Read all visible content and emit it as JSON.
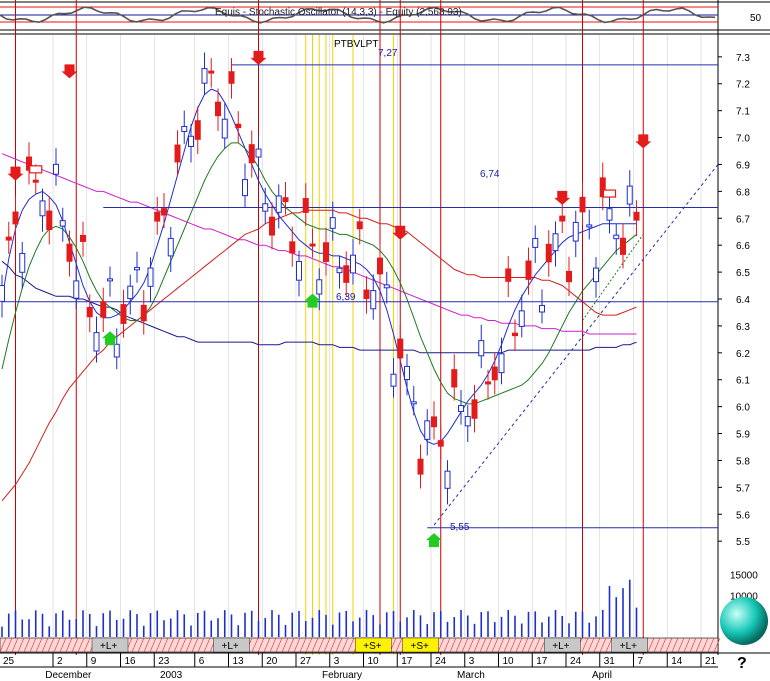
{
  "indicator_title": "Equis - Stochastic Oscillator (14,3,3) - Equity (2,568.93)",
  "indicator_level": "50",
  "top_label": "PTBVLPT",
  "help_glyph": "?",
  "colors": {
    "bull": "#1e2fd0",
    "bear": "#e41b1b",
    "ma_blue": "#1a1a8c",
    "ma_green": "#1f7a1f",
    "ma_red": "#d22020",
    "ma_magenta": "#cc22cc",
    "vline_red": "#cc0000",
    "vline_yellow": "#f2d400",
    "level_line": "#2a2ab0",
    "sphere": "#18c8b8"
  },
  "chart_data": {
    "type": "candlestick",
    "ylim": [
      5.43,
      7.37
    ],
    "y_ticks": [
      "7.3",
      "7.2",
      "7.1",
      "7.0",
      "6.9",
      "6.8",
      "6.7",
      "6.6",
      "6.5",
      "6.4",
      "6.3",
      "6.2",
      "6.1",
      "6.0",
      "5.9",
      "5.8",
      "5.7",
      "5.6",
      "5.5"
    ],
    "y_tick_values": [
      7.3,
      7.2,
      7.1,
      7.0,
      6.9,
      6.8,
      6.7,
      6.6,
      6.5,
      6.4,
      6.3,
      6.2,
      6.1,
      6.0,
      5.9,
      5.8,
      5.7,
      5.6,
      5.5
    ],
    "volume_ticks": [
      "15000",
      "10000"
    ],
    "volume_tick_values": [
      15000,
      10000
    ],
    "volume_max": 19000,
    "n_bars": 95,
    "day_labels": [
      {
        "i": 0,
        "t": "25"
      },
      {
        "i": 8,
        "t": "2"
      },
      {
        "i": 13,
        "t": "9"
      },
      {
        "i": 18,
        "t": "16"
      },
      {
        "i": 23,
        "t": "23"
      },
      {
        "i": 29,
        "t": "6"
      },
      {
        "i": 34,
        "t": "13"
      },
      {
        "i": 39,
        "t": "20"
      },
      {
        "i": 44,
        "t": "27"
      },
      {
        "i": 49,
        "t": "3"
      },
      {
        "i": 54,
        "t": "10"
      },
      {
        "i": 59,
        "t": "17"
      },
      {
        "i": 64,
        "t": "24"
      },
      {
        "i": 69,
        "t": "3"
      },
      {
        "i": 74,
        "t": "10"
      },
      {
        "i": 79,
        "t": "17"
      },
      {
        "i": 84,
        "t": "24"
      },
      {
        "i": 89,
        "t": "31"
      },
      {
        "i": 94,
        "t": "7"
      },
      {
        "i": 99,
        "t": "14"
      },
      {
        "i": 104,
        "t": "21"
      }
    ],
    "month_labels": [
      {
        "i": 7,
        "t": "December"
      },
      {
        "i": 24,
        "t": "2003"
      },
      {
        "i": 48,
        "t": "February"
      },
      {
        "i": 68,
        "t": "March"
      },
      {
        "i": 88,
        "t": "April"
      }
    ],
    "level_lines": [
      {
        "y": 7.27,
        "label": "7,27",
        "from": 34
      },
      {
        "y": 6.74,
        "label": "6,74",
        "from": 15
      },
      {
        "y": 6.39,
        "label": "6,39",
        "from": 0
      },
      {
        "y": 5.55,
        "label": "5,55",
        "from": 63
      }
    ],
    "signal_bars": [
      {
        "i": 16,
        "t": "+L+"
      },
      {
        "i": 34,
        "t": "+L+"
      },
      {
        "i": 55,
        "t": "+S+"
      },
      {
        "i": 62,
        "t": "+S+"
      },
      {
        "i": 83,
        "t": "+L+"
      },
      {
        "i": 93,
        "t": "+L+"
      }
    ],
    "red_vlines": [
      2,
      11,
      38,
      56,
      59,
      65,
      86,
      95
    ],
    "yellow_vlines": [
      45,
      46,
      47,
      48,
      49,
      52,
      58
    ],
    "down_arrows": [
      {
        "i": 2,
        "y": 6.84
      },
      {
        "i": 10,
        "y": 7.22
      },
      {
        "i": 38,
        "y": 7.27
      },
      {
        "i": 59,
        "y": 6.62
      },
      {
        "i": 83,
        "y": 6.75
      },
      {
        "i": 95,
        "y": 6.96
      }
    ],
    "up_arrows": [
      {
        "i": 16,
        "y": 6.28
      },
      {
        "i": 46,
        "y": 6.42
      },
      {
        "i": 64,
        "y": 5.53
      }
    ],
    "box_markers": [
      {
        "i": 5,
        "y": 6.88
      },
      {
        "i": 90,
        "y": 6.79
      }
    ],
    "ma_series": [
      {
        "color": "#1a1a8c",
        "values": [
          6.54,
          6.52,
          6.49,
          6.48,
          6.46,
          6.44,
          6.43,
          6.42,
          6.41,
          6.41,
          6.41,
          6.4,
          6.4,
          6.39,
          6.38,
          6.37,
          6.37,
          6.36,
          6.34,
          6.33,
          6.32,
          6.31,
          6.3,
          6.29,
          6.28,
          6.27,
          6.26,
          6.26,
          6.25,
          6.24,
          6.24,
          6.24,
          6.24,
          6.24,
          6.24,
          6.24,
          6.24,
          6.24,
          6.23,
          6.23,
          6.23,
          6.23,
          6.24,
          6.24,
          6.24,
          6.24,
          6.24,
          6.23,
          6.23,
          6.23,
          6.22,
          6.22,
          6.22,
          6.21,
          6.21,
          6.21,
          6.21,
          6.21,
          6.21,
          6.21,
          6.21,
          6.21,
          6.2,
          6.2,
          6.2,
          6.2,
          6.2,
          6.2,
          6.2,
          6.2,
          6.2,
          6.2,
          6.2,
          6.2,
          6.2,
          6.21,
          6.21,
          6.21,
          6.21,
          6.21,
          6.21,
          6.21,
          6.21,
          6.21,
          6.21,
          6.21,
          6.21,
          6.21,
          6.22,
          6.22,
          6.22,
          6.22,
          6.23,
          6.23,
          6.24
        ]
      },
      {
        "color": "#cc22cc",
        "values": [
          6.94,
          6.93,
          6.92,
          6.91,
          6.9,
          6.89,
          6.88,
          6.87,
          6.86,
          6.85,
          6.84,
          6.83,
          6.82,
          6.81,
          6.8,
          6.8,
          6.79,
          6.78,
          6.77,
          6.76,
          6.76,
          6.75,
          6.74,
          6.73,
          6.72,
          6.71,
          6.7,
          6.69,
          6.68,
          6.67,
          6.66,
          6.66,
          6.65,
          6.64,
          6.63,
          6.62,
          6.62,
          6.61,
          6.6,
          6.6,
          6.59,
          6.58,
          6.58,
          6.57,
          6.56,
          6.56,
          6.55,
          6.54,
          6.53,
          6.52,
          6.52,
          6.51,
          6.5,
          6.49,
          6.48,
          6.47,
          6.46,
          6.45,
          6.44,
          6.43,
          6.42,
          6.41,
          6.4,
          6.39,
          6.38,
          6.37,
          6.36,
          6.35,
          6.34,
          6.34,
          6.33,
          6.33,
          6.32,
          6.32,
          6.31,
          6.31,
          6.31,
          6.3,
          6.3,
          6.3,
          6.29,
          6.29,
          6.29,
          6.28,
          6.28,
          6.28,
          6.28,
          6.27,
          6.27,
          6.27,
          6.27,
          6.27,
          6.27,
          6.27,
          6.27
        ]
      },
      {
        "color": "#d22020",
        "values": [
          5.65,
          5.68,
          5.71,
          5.75,
          5.79,
          5.84,
          5.89,
          5.94,
          5.98,
          6.03,
          6.07,
          6.1,
          6.13,
          6.16,
          6.19,
          6.21,
          6.24,
          6.26,
          6.28,
          6.3,
          6.32,
          6.34,
          6.36,
          6.38,
          6.4,
          6.42,
          6.44,
          6.46,
          6.48,
          6.5,
          6.52,
          6.54,
          6.56,
          6.58,
          6.6,
          6.62,
          6.64,
          6.65,
          6.66,
          6.68,
          6.69,
          6.7,
          6.71,
          6.72,
          6.72,
          6.73,
          6.73,
          6.73,
          6.73,
          6.73,
          6.72,
          6.72,
          6.71,
          6.7,
          6.7,
          6.69,
          6.68,
          6.68,
          6.67,
          6.66,
          6.65,
          6.63,
          6.61,
          6.59,
          6.57,
          6.55,
          6.53,
          6.51,
          6.5,
          6.49,
          6.49,
          6.48,
          6.48,
          6.48,
          6.48,
          6.48,
          6.48,
          6.48,
          6.48,
          6.48,
          6.47,
          6.47,
          6.46,
          6.45,
          6.43,
          6.41,
          6.39,
          6.37,
          6.35,
          6.34,
          6.34,
          6.34,
          6.35,
          6.36,
          6.37
        ]
      },
      {
        "color": "#1f7a1f",
        "values": [
          6.14,
          6.25,
          6.35,
          6.44,
          6.52,
          6.58,
          6.63,
          6.66,
          6.67,
          6.66,
          6.63,
          6.59,
          6.54,
          6.48,
          6.43,
          6.39,
          6.37,
          6.35,
          6.33,
          6.32,
          6.32,
          6.34,
          6.37,
          6.42,
          6.48,
          6.54,
          6.6,
          6.66,
          6.72,
          6.78,
          6.84,
          6.89,
          6.93,
          6.96,
          6.98,
          6.98,
          6.96,
          6.93,
          6.89,
          6.84,
          6.8,
          6.77,
          6.74,
          6.72,
          6.7,
          6.68,
          6.67,
          6.66,
          6.66,
          6.65,
          6.64,
          6.64,
          6.63,
          6.62,
          6.61,
          6.6,
          6.58,
          6.55,
          6.51,
          6.46,
          6.4,
          6.33,
          6.26,
          6.2,
          6.14,
          6.09,
          6.05,
          6.03,
          6.02,
          6.01,
          6.01,
          6.02,
          6.03,
          6.04,
          6.05,
          6.06,
          6.07,
          6.08,
          6.1,
          6.13,
          6.16,
          6.2,
          6.25,
          6.3,
          6.35,
          6.39,
          6.43,
          6.46,
          6.49,
          6.52,
          6.55,
          6.58,
          6.6,
          6.62,
          6.64
        ]
      },
      {
        "color": "#1e2fd0",
        "values": [
          6.4,
          6.55,
          6.66,
          6.73,
          6.77,
          6.79,
          6.8,
          6.78,
          6.75,
          6.69,
          6.61,
          6.53,
          6.45,
          6.39,
          6.35,
          6.33,
          6.33,
          6.34,
          6.36,
          6.39,
          6.42,
          6.46,
          6.52,
          6.6,
          6.68,
          6.77,
          6.86,
          6.95,
          7.04,
          7.11,
          7.16,
          7.18,
          7.17,
          7.13,
          7.08,
          7.02,
          6.96,
          6.9,
          6.84,
          6.79,
          6.75,
          6.71,
          6.68,
          6.65,
          6.62,
          6.6,
          6.58,
          6.57,
          6.57,
          6.56,
          6.56,
          6.55,
          6.54,
          6.53,
          6.51,
          6.48,
          6.43,
          6.36,
          6.27,
          6.17,
          6.07,
          5.98,
          5.91,
          5.87,
          5.86,
          5.87,
          5.9,
          5.94,
          5.98,
          6.02,
          6.05,
          6.08,
          6.12,
          6.17,
          6.23,
          6.3,
          6.36,
          6.41,
          6.45,
          6.49,
          6.52,
          6.55,
          6.58,
          6.61,
          6.63,
          6.64,
          6.65,
          6.66,
          6.67,
          6.68,
          6.68,
          6.68,
          6.68,
          6.68,
          6.68
        ]
      }
    ]
  }
}
